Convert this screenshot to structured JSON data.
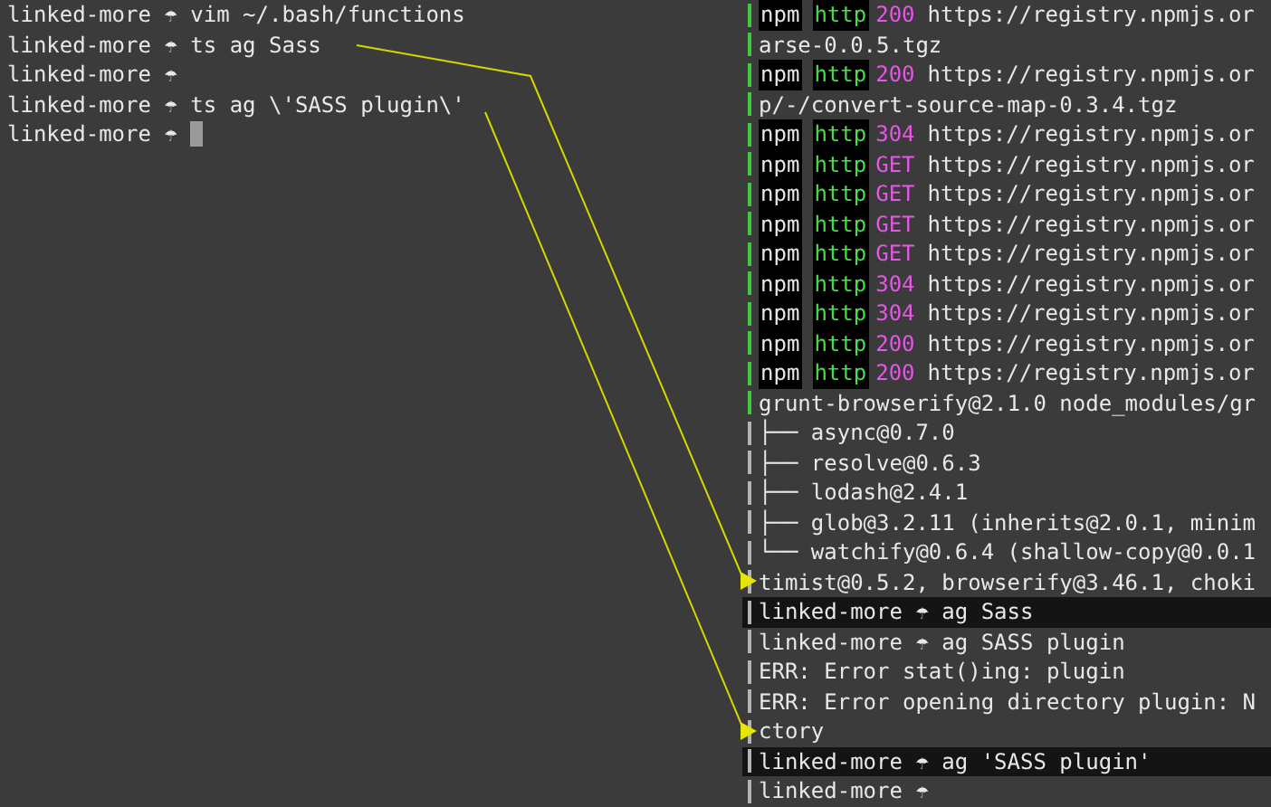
{
  "left_pane": {
    "lines": [
      {
        "text": "linked-more ☂ vim ~/.bash/functions",
        "cursor": false
      },
      {
        "text": "linked-more ☂ ts ag Sass",
        "cursor": false
      },
      {
        "text": "linked-more ☂",
        "cursor": false
      },
      {
        "text": "linked-more ☂ ts ag \\'SASS plugin\\'",
        "cursor": false
      },
      {
        "text": "linked-more ☂",
        "cursor": true
      }
    ]
  },
  "right_pane": {
    "lines": [
      {
        "kind": "npm",
        "color": "#3ec83e",
        "highlighted": false,
        "tool": "npm",
        "protocol": "http",
        "status": "200",
        "url": "https://registry.npmjs.or"
      },
      {
        "kind": "text",
        "color": "#3ec83e",
        "highlighted": false,
        "text": "arse-0.0.5.tgz"
      },
      {
        "kind": "npm",
        "color": "#3ec83e",
        "highlighted": false,
        "tool": "npm",
        "protocol": "http",
        "status": "200",
        "url": "https://registry.npmjs.or"
      },
      {
        "kind": "text",
        "color": "#3ec83e",
        "highlighted": false,
        "text": "p/-/convert-source-map-0.3.4.tgz"
      },
      {
        "kind": "npm",
        "color": "#3ec83e",
        "highlighted": false,
        "tool": "npm",
        "protocol": "http",
        "status": "304",
        "url": "https://registry.npmjs.or"
      },
      {
        "kind": "npm",
        "color": "#3ec83e",
        "highlighted": false,
        "tool": "npm",
        "protocol": "http",
        "status": "GET",
        "url": "https://registry.npmjs.or"
      },
      {
        "kind": "npm",
        "color": "#3ec83e",
        "highlighted": false,
        "tool": "npm",
        "protocol": "http",
        "status": "GET",
        "url": "https://registry.npmjs.or"
      },
      {
        "kind": "npm",
        "color": "#3ec83e",
        "highlighted": false,
        "tool": "npm",
        "protocol": "http",
        "status": "GET",
        "url": "https://registry.npmjs.or"
      },
      {
        "kind": "npm",
        "color": "#3ec83e",
        "highlighted": false,
        "tool": "npm",
        "protocol": "http",
        "status": "GET",
        "url": "https://registry.npmjs.or"
      },
      {
        "kind": "npm",
        "color": "#3ec83e",
        "highlighted": false,
        "tool": "npm",
        "protocol": "http",
        "status": "304",
        "url": "https://registry.npmjs.or"
      },
      {
        "kind": "npm",
        "color": "#3ec83e",
        "highlighted": false,
        "tool": "npm",
        "protocol": "http",
        "status": "304",
        "url": "https://registry.npmjs.or"
      },
      {
        "kind": "npm",
        "color": "#3ec83e",
        "highlighted": false,
        "tool": "npm",
        "protocol": "http",
        "status": "200",
        "url": "https://registry.npmjs.or"
      },
      {
        "kind": "npm",
        "color": "#3ec83e",
        "highlighted": false,
        "tool": "npm",
        "protocol": "http",
        "status": "200",
        "url": "https://registry.npmjs.or"
      },
      {
        "kind": "text",
        "color": "#3ec83e",
        "highlighted": false,
        "text": "grunt-browserify@2.1.0 node_modules/gr"
      },
      {
        "kind": "text",
        "color": "#b4b4b4",
        "highlighted": false,
        "text": "├── async@0.7.0"
      },
      {
        "kind": "text",
        "color": "#b4b4b4",
        "highlighted": false,
        "text": "├── resolve@0.6.3"
      },
      {
        "kind": "text",
        "color": "#b4b4b4",
        "highlighted": false,
        "text": "├── lodash@2.4.1"
      },
      {
        "kind": "text",
        "color": "#b4b4b4",
        "highlighted": false,
        "text": "├── glob@3.2.11 (inherits@2.0.1, minim"
      },
      {
        "kind": "text",
        "color": "#b4b4b4",
        "highlighted": false,
        "text": "└── watchify@0.6.4 (shallow-copy@0.0.1"
      },
      {
        "kind": "text",
        "color": "#b4b4b4",
        "highlighted": false,
        "text": "timist@0.5.2, browserify@3.46.1, choki"
      },
      {
        "kind": "text",
        "color": "#b4b4b4",
        "highlighted": true,
        "text": "linked-more ☂ ag Sass"
      },
      {
        "kind": "text",
        "color": "#b4b4b4",
        "highlighted": false,
        "text": "linked-more ☂ ag SASS plugin"
      },
      {
        "kind": "text",
        "color": "#b4b4b4",
        "highlighted": false,
        "text": "ERR: Error stat()ing: plugin"
      },
      {
        "kind": "text",
        "color": "#b4b4b4",
        "highlighted": false,
        "text": "ERR: Error opening directory plugin: N"
      },
      {
        "kind": "text",
        "color": "#b4b4b4",
        "highlighted": false,
        "text": "ctory"
      },
      {
        "kind": "text",
        "color": "#b4b4b4",
        "highlighted": true,
        "text": "linked-more ☂ ag 'SASS plugin'"
      },
      {
        "kind": "text",
        "color": "#b4b4b4",
        "highlighted": false,
        "text": "linked-more ☂"
      }
    ]
  }
}
